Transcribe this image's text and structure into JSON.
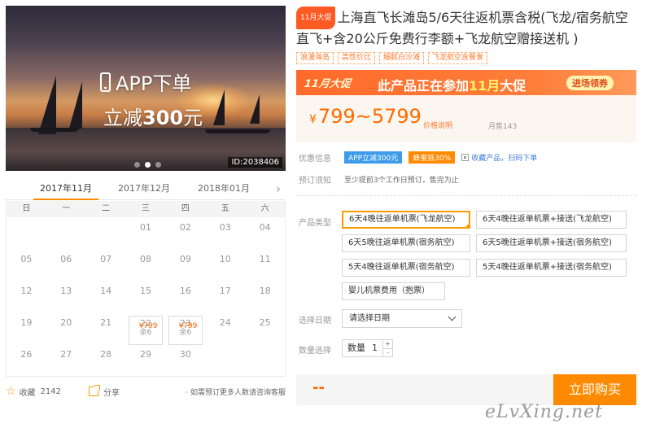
{
  "hero": {
    "app_text": "APP下单",
    "discount_prefix": "立减",
    "discount_amount": "300",
    "discount_suffix": "元",
    "image_id": "ID:2038406",
    "slides": 3,
    "active_slide": 2
  },
  "calendar": {
    "months": [
      "2017年11月",
      "2017年12月",
      "2018年01月"
    ],
    "active_month": "2017年11月",
    "weekdays": [
      "日",
      "一",
      "二",
      "三",
      "四",
      "五",
      "六"
    ],
    "rows": [
      [
        null,
        null,
        null,
        {
          "day": "01"
        },
        {
          "day": "02"
        },
        {
          "day": "03"
        },
        {
          "day": "04"
        }
      ],
      [
        {
          "day": "05"
        },
        {
          "day": "06"
        },
        {
          "day": "07"
        },
        {
          "day": "08"
        },
        {
          "day": "09"
        },
        {
          "day": "10"
        },
        {
          "day": "11"
        }
      ],
      [
        {
          "day": "12"
        },
        {
          "day": "13"
        },
        {
          "day": "14"
        },
        {
          "day": "15"
        },
        {
          "day": "16"
        },
        {
          "day": "17"
        },
        {
          "day": "18"
        }
      ],
      [
        {
          "day": "19"
        },
        {
          "day": "20"
        },
        {
          "day": "21"
        },
        {
          "day": "22",
          "price": "¥799",
          "left": "余6"
        },
        {
          "day": "23",
          "price": "¥799",
          "left": "余6"
        },
        {
          "day": "24"
        },
        {
          "day": "25"
        }
      ],
      [
        {
          "day": "26"
        },
        {
          "day": "27"
        },
        {
          "day": "28"
        },
        {
          "day": "29"
        },
        {
          "day": "30"
        },
        null,
        null
      ]
    ]
  },
  "share_bar": {
    "favorite_label": "收藏",
    "favorite_count": "2142",
    "share_label": "分享",
    "note": "· 如需预订更多人数请咨询客服"
  },
  "product": {
    "badge": "11月大促",
    "title": "上海直飞长滩岛5/6天往返机票含税(飞龙/宿务航空直飞+含20公斤免费行李额+飞龙航空赠接送机 )",
    "tags": [
      "浪漫海岛",
      "高性价比",
      "细腻白沙滩",
      "飞龙航空含餐食"
    ]
  },
  "promo": {
    "label": "11月大促",
    "text_prefix": "此产品正在参加",
    "text_highlight": "11月",
    "text_suffix": "大促",
    "button": "进场领券"
  },
  "price": {
    "currency": "¥",
    "range": "799~5799",
    "note": "价格说明",
    "sold": "月售143"
  },
  "offers": {
    "label": "优惠信息",
    "chip_app": "APP立减300元",
    "chip_coupon": "蜂蜜抵30%",
    "qr_text": "收藏产品，扫码下单"
  },
  "booking": {
    "label": "预订须知",
    "note": "至少提前3个工作日预订，售完为止"
  },
  "options": {
    "label": "产品类型",
    "items": [
      "6天4晚往返单机票(飞龙航空)",
      "6天4晚往返单机票+接送(飞龙航空)",
      "6天5晚往返单机票(宿务航空)",
      "6天5晚往返单机票+接送(宿务航空)",
      "5天4晚往返单机票(宿务航空)",
      "5天4晚往返单机票+接送(宿务航空)",
      "婴儿机票费用（抱票）"
    ],
    "selected_index": 0
  },
  "date": {
    "label": "选择日期",
    "placeholder": "请选择日期"
  },
  "quantity": {
    "label": "数量选择",
    "field_label": "数量",
    "value": "1",
    "plus": "+",
    "minus": "-"
  },
  "buy": {
    "total": "--",
    "button": "立即购买"
  },
  "watermark": "eLvXing.net",
  "colors": {
    "accent": "#ff8a00",
    "price": "#ff6a00",
    "promo_bg": "#ff6a2a",
    "link_blue": "#3d9be9"
  }
}
